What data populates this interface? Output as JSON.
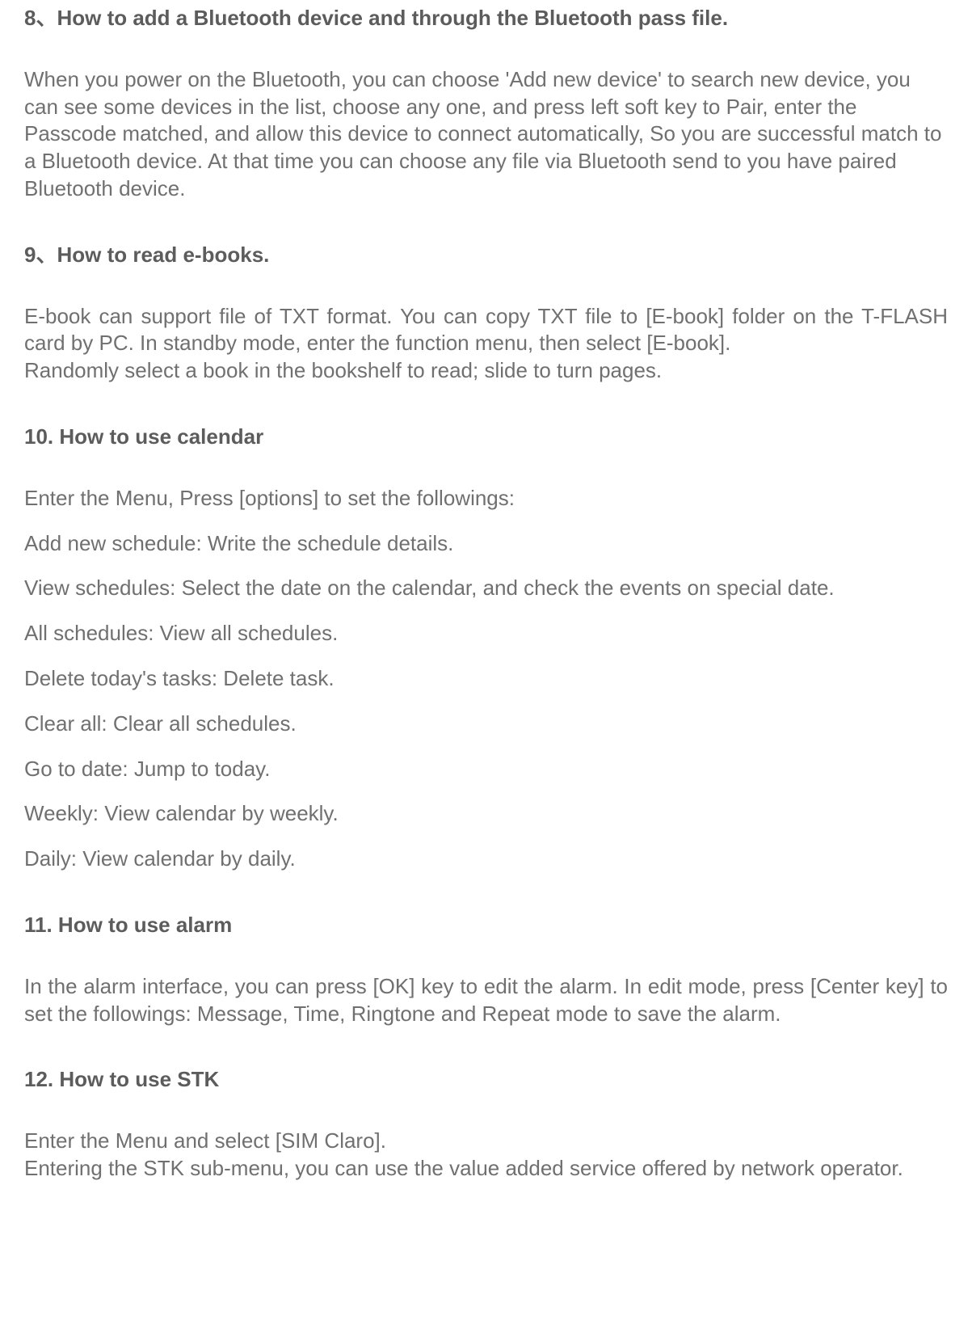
{
  "sections": {
    "s8": {
      "heading": "8、How to add a Bluetooth device and through the Bluetooth pass file.",
      "p1": "When you power on the Bluetooth, you can choose 'Add new device' to search new device, you can see some devices in the list, choose any one, and press left soft key to Pair, enter the Passcode matched, and allow this device to connect automatically, So you are successful match to a Bluetooth device. At that time you can choose any file via Bluetooth send to you have paired Bluetooth device."
    },
    "s9": {
      "heading": "9、How to read e-books.",
      "p1": "E-book can support file of TXT format. You can copy TXT file to [E-book] folder on the T-FLASH card by PC. In standby mode, enter the function menu, then select [E-book].",
      "p2": "Randomly select a book in the bookshelf to read; slide to turn pages."
    },
    "s10": {
      "heading": "10. How to use calendar",
      "p1": "Enter the Menu, Press [options] to set the followings:",
      "items": [
        "Add new schedule: Write the schedule details.",
        "View schedules: Select the date on the calendar, and check the events on special date.",
        "All schedules: View all schedules.",
        "Delete today's tasks: Delete task.",
        "Clear all: Clear all schedules.",
        "Go to date: Jump to today.",
        "Weekly: View calendar by weekly.",
        "Daily: View calendar by daily."
      ]
    },
    "s11": {
      "heading": "11. How to use alarm",
      "p1": "In the alarm interface, you can press [OK] key to edit the alarm. In edit mode, press [Center key] to set the followings: Message, Time, Ringtone and Repeat mode to save the alarm."
    },
    "s12": {
      "heading": "12. How to use STK",
      "p1": "Enter the Menu and select [SIM Claro].",
      "p2": "Entering the STK sub-menu, you can use the value added service offered by network operator."
    }
  }
}
